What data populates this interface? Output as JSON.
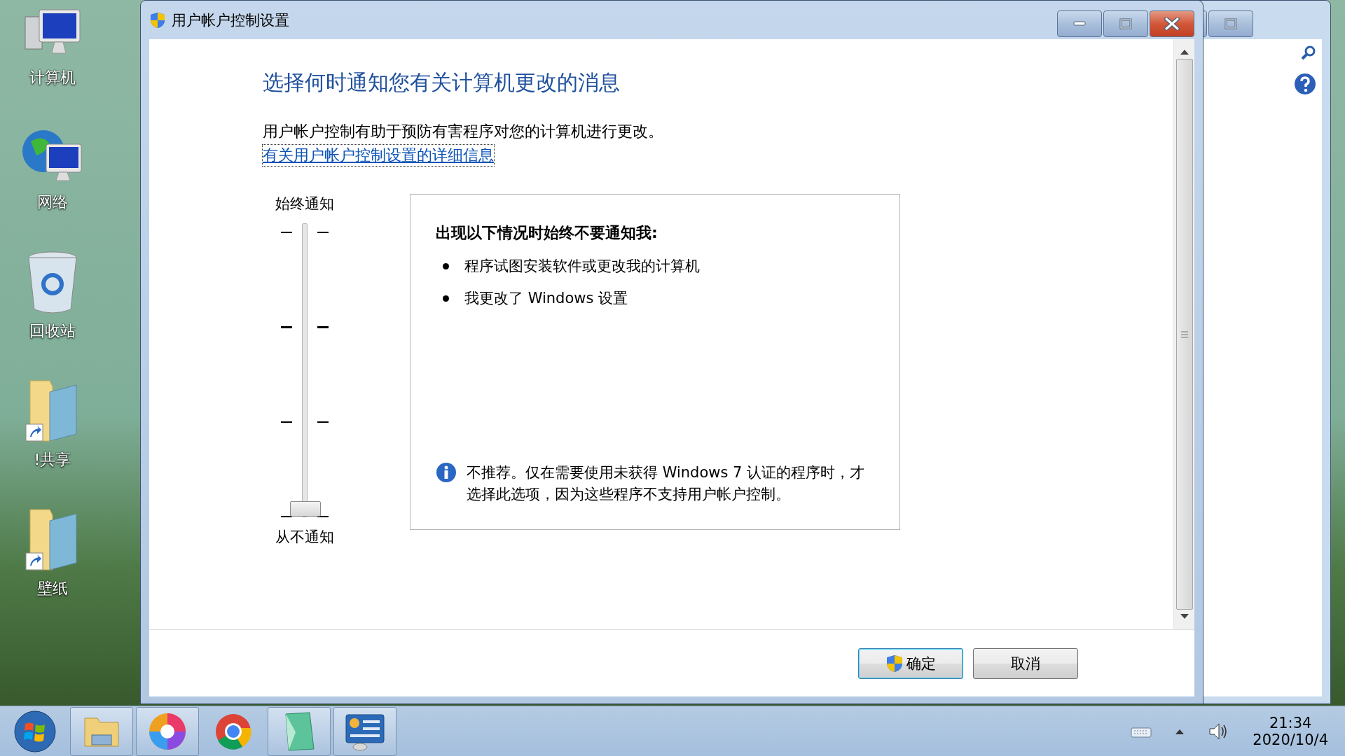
{
  "desktop_icons": [
    {
      "kind": "computer",
      "label": "计算机"
    },
    {
      "kind": "network",
      "label": "网络"
    },
    {
      "kind": "recycle",
      "label": "回收站"
    },
    {
      "kind": "folder",
      "label": "!共享"
    },
    {
      "kind": "folder",
      "label": "壁纸"
    }
  ],
  "dialog": {
    "title": "用户帐户控制设置",
    "heading": "选择何时通知您有关计算机更改的消息",
    "description": "用户帐户控制有助于预防有害程序对您的计算机进行更改。",
    "link": "有关用户帐户控制设置的详细信息",
    "slider": {
      "top_label": "始终通知",
      "bottom_label": "从不通知",
      "level": 0
    },
    "info_panel": {
      "title": "出现以下情况时始终不要通知我:",
      "bullets": [
        "程序试图安装软件或更改我的计算机",
        "我更改了 Windows 设置"
      ],
      "note": "不推荐。仅在需要使用未获得 Windows 7 认证的程序时，才选择此选项，因为这些程序不支持用户帐户控制。"
    },
    "buttons": [
      {
        "kind": "shield",
        "label": "确定"
      },
      {
        "kind": "plain",
        "label": "取消"
      }
    ]
  },
  "taskbar": {
    "apps": [
      {
        "kind": "explorer",
        "running": true
      },
      {
        "kind": "pinwheel",
        "running": true
      },
      {
        "kind": "chrome",
        "running": false
      },
      {
        "kind": "notebook",
        "running": true
      },
      {
        "kind": "control-panel",
        "running": true
      }
    ],
    "time": "21:34",
    "date": "2020/10/4"
  }
}
